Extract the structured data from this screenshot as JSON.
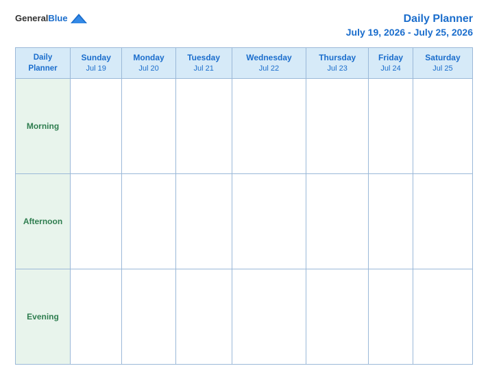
{
  "header": {
    "logo_general": "General",
    "logo_blue": "Blue",
    "title": "Daily Planner",
    "date_range": "July 19, 2026 - July 25, 2026"
  },
  "table": {
    "header_label": "Daily\nPlanner",
    "columns": [
      {
        "day": "Sunday",
        "date": "Jul 19"
      },
      {
        "day": "Monday",
        "date": "Jul 20"
      },
      {
        "day": "Tuesday",
        "date": "Jul 21"
      },
      {
        "day": "Wednesday",
        "date": "Jul 22"
      },
      {
        "day": "Thursday",
        "date": "Jul 23"
      },
      {
        "day": "Friday",
        "date": "Jul 24"
      },
      {
        "day": "Saturday",
        "date": "Jul 25"
      }
    ],
    "rows": [
      {
        "label": "Morning"
      },
      {
        "label": "Afternoon"
      },
      {
        "label": "Evening"
      }
    ]
  }
}
